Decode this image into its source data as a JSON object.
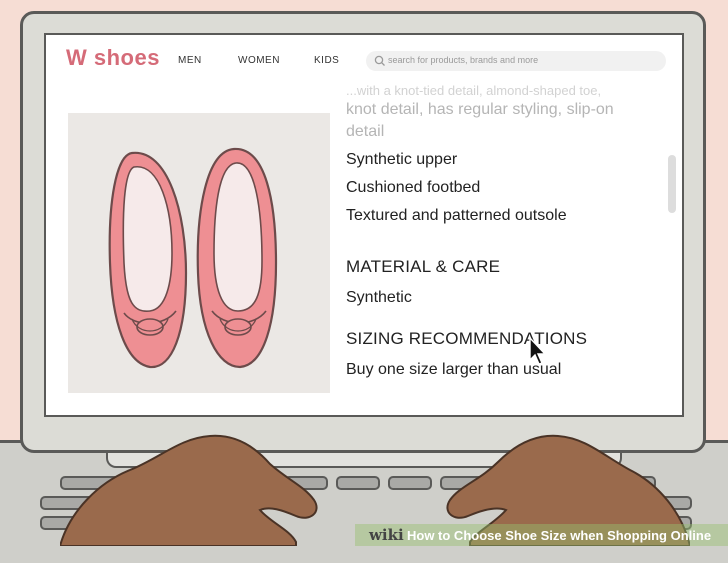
{
  "brand": {
    "logo": "W shoes",
    "color": "#d56b78"
  },
  "nav": {
    "items": [
      "MEN",
      "WOMEN",
      "KIDS"
    ]
  },
  "search": {
    "placeholder": "search for products, brands and more",
    "icon": "search-icon"
  },
  "product": {
    "description_partial_top": "...with a knot-tied detail, almond-shaped toe,",
    "description_line_2": "knot detail, has regular styling, slip-on",
    "description_line_3": "detail",
    "features": [
      "Synthetic upper",
      "Cushioned footbed",
      "Textured and patterned outsole"
    ],
    "material_heading": "MATERIAL & CARE",
    "material_value": "Synthetic",
    "sizing_heading": "SIZING RECOMMENDATIONS",
    "sizing_value": "Buy one size larger than usual"
  },
  "caption": {
    "brand": "wiki",
    "title": "How to Choose Shoe Size when Shopping Online"
  }
}
